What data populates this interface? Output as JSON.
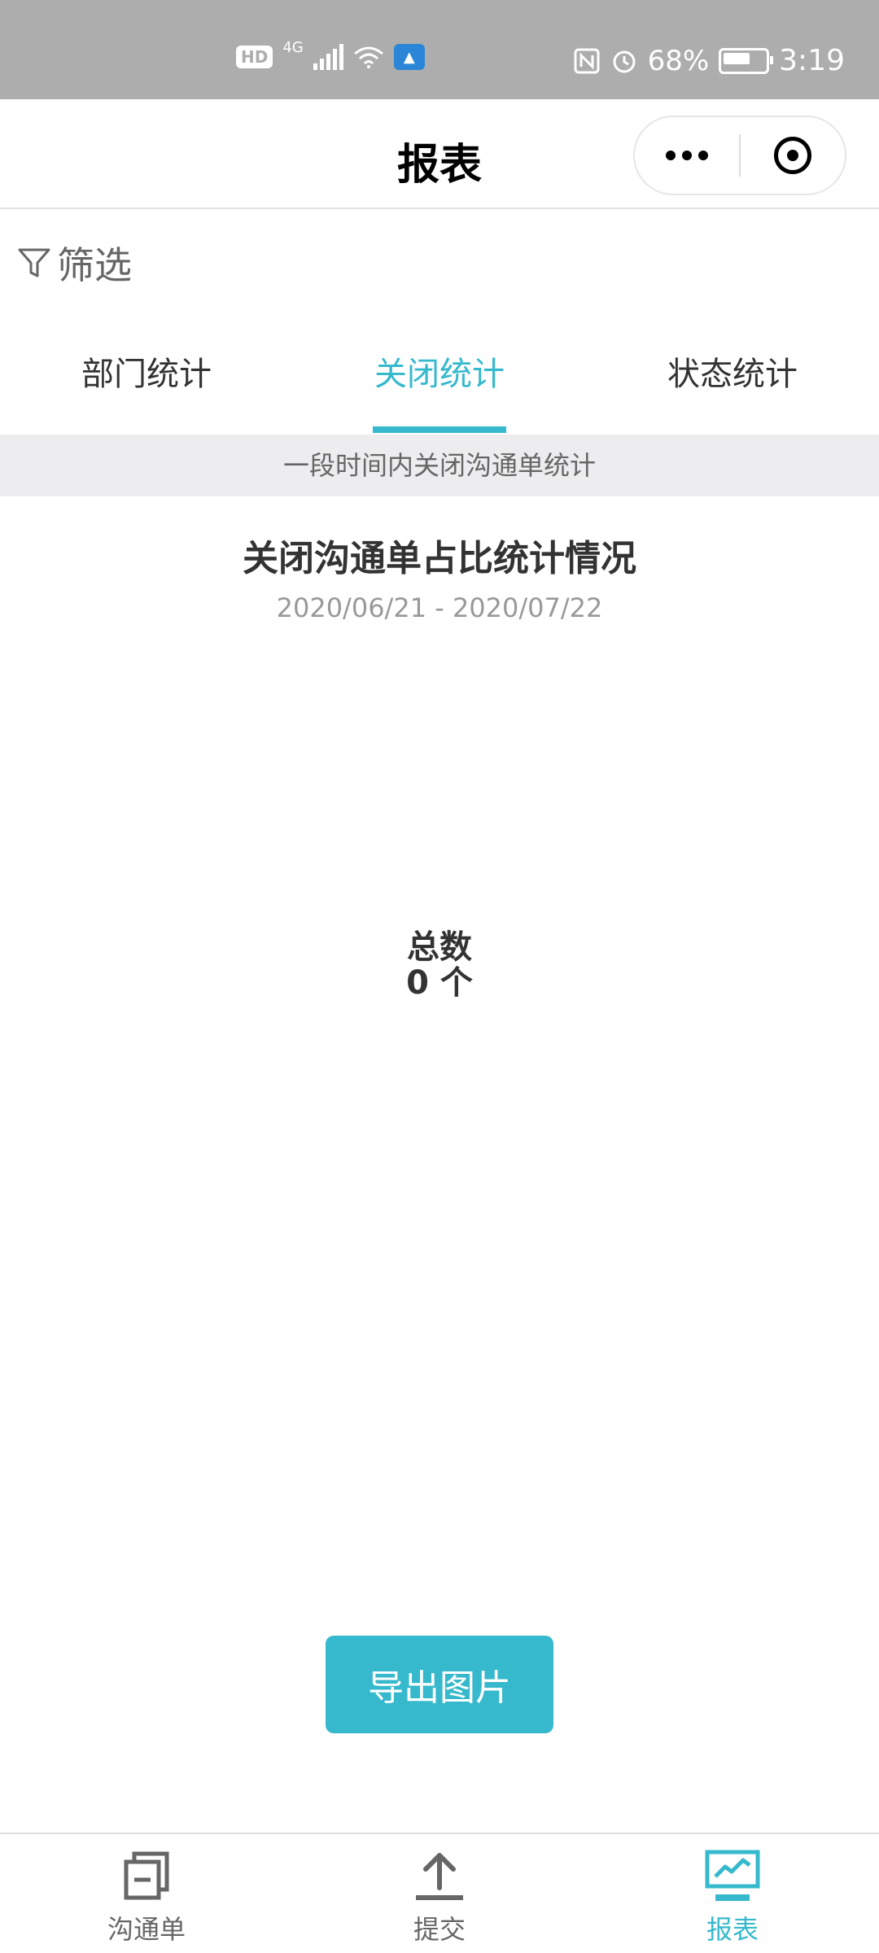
{
  "status_bar": {
    "hd": "HD",
    "network": "4G",
    "battery": "68%",
    "time": "3:19"
  },
  "header": {
    "title": "报表"
  },
  "filter": {
    "label": "筛选"
  },
  "tabs": [
    {
      "label": "部门统计",
      "active": false
    },
    {
      "label": "关闭统计",
      "active": true
    },
    {
      "label": "状态统计",
      "active": false
    }
  ],
  "info_strip": "一段时间内关闭沟通单统计",
  "chart": {
    "title": "关闭沟通单占比统计情况",
    "date_range": "2020/06/21 - 2020/07/22",
    "total_label": "总数",
    "total_value": "0 个"
  },
  "export_button": "导出图片",
  "bottom_nav": [
    {
      "label": "沟通单",
      "active": false
    },
    {
      "label": "提交",
      "active": false
    },
    {
      "label": "报表",
      "active": true
    }
  ],
  "colors": {
    "accent": "#36b9cc",
    "status_bar": "#acadac"
  }
}
